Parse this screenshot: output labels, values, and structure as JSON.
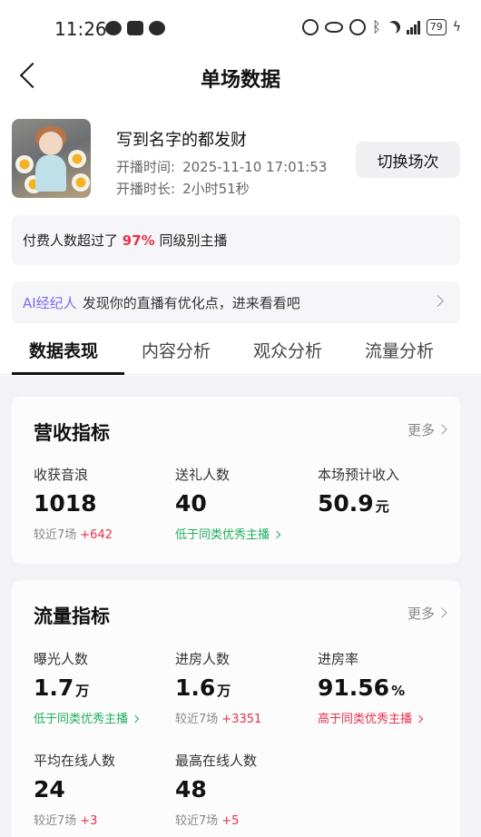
{
  "status_bar": {
    "time": "11:26",
    "battery": "79"
  },
  "header": {
    "title": "单场数据"
  },
  "stream": {
    "title": "写到名字的都发财",
    "start_label": "开播时间:",
    "start_value": "2025-11-10 17:01:53",
    "duration_label": "开播时长:",
    "duration_value": "2小时51秒",
    "switch_label": "切换场次"
  },
  "pay_notice": {
    "prefix": "付费人数超过了",
    "percent": "97%",
    "suffix": "同级别主播"
  },
  "ai_banner": {
    "tag": "AI经纪人",
    "text": "发现你的直播有优化点，进来看看吧"
  },
  "tabs": [
    {
      "label": "数据表现"
    },
    {
      "label": "内容分析"
    },
    {
      "label": "观众分析"
    },
    {
      "label": "流量分析"
    }
  ],
  "revenue": {
    "title": "营收指标",
    "more": "更多",
    "metrics": [
      {
        "label": "收获音浪",
        "value": "1018",
        "unit": "",
        "sub_prefix": "较近7场",
        "sub_delta": "+642"
      },
      {
        "label": "送礼人数",
        "value": "40",
        "unit": "",
        "sub_text": "低于同类优秀主播"
      },
      {
        "label": "本场预计收入",
        "value": "50.9",
        "unit": "元"
      }
    ]
  },
  "traffic": {
    "title": "流量指标",
    "more": "更多",
    "metrics": [
      {
        "label": "曝光人数",
        "value": "1.7",
        "unit": "万",
        "sub_text": "低于同类优秀主播"
      },
      {
        "label": "进房人数",
        "value": "1.6",
        "unit": "万",
        "sub_prefix": "较近7场",
        "sub_delta": "+3351"
      },
      {
        "label": "进房率",
        "value": "91.56",
        "unit": "%",
        "sub_text": "高于同类优秀主播"
      },
      {
        "label": "平均在线人数",
        "value": "24",
        "unit": "",
        "sub_prefix": "较近7场",
        "sub_delta": "+3"
      },
      {
        "label": "最高在线人数",
        "value": "48",
        "unit": "",
        "sub_prefix": "较近7场",
        "sub_delta": "+5"
      }
    ]
  },
  "colors": {
    "accent_red": "#e8304c",
    "accent_green": "#1fae5d",
    "ai_purple": "#7b6cf0"
  }
}
